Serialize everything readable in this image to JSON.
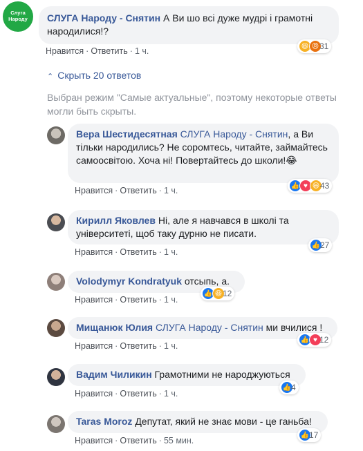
{
  "top_comment": {
    "author": "СЛУГА Народу - Снятин",
    "text": "А Ви шо всі дуже мудрі і грамотні народилися!?",
    "actions": [
      "Нравится",
      "Ответить"
    ],
    "time": "1 ч.",
    "reaction_count": "31",
    "reactions": [
      "haha-reaction-icon",
      "angry-reaction-icon"
    ],
    "avatar_logo": "Слуга Народу"
  },
  "replies_toggle": "Скрыть 20 ответов",
  "sort_notice": "Выбран режим \"Самые актуальные\", поэтому некоторые ответы могли быть скрыты.",
  "replies": [
    {
      "author": "Вера Шестидесятная",
      "mention": "СЛУГА Народу - Снятин",
      "text": ", а Ви тільки народились? Не соромтесь, читайте, займайтесь самоосвітою. Хоча ні! Повертайтесь до школи!",
      "emoji": "😂",
      "time": "1 ч.",
      "count": "43"
    },
    {
      "author": "Кирилл Яковлев",
      "mention": "",
      "text": "Ні, але я навчався в школі та університеті, щоб таку дурню не писати.",
      "time": "1 ч.",
      "count": "27"
    },
    {
      "author": "Volodymyr Kondratyuk",
      "mention": "",
      "text": "отсыпь, а.",
      "time": "1 ч.",
      "count": "12"
    },
    {
      "author": "Мищанюк Юлия",
      "mention": "СЛУГА Народу - Снятин",
      "text": "ми вчилися !",
      "time": "1 ч.",
      "count": "12"
    },
    {
      "author": "Вадим Чиликин",
      "mention": "",
      "text": "Грамотними не народжуються",
      "time": "1 ч.",
      "count": "4"
    },
    {
      "author": "Taras Moroz",
      "mention": "",
      "text": "Депутат, який не знає мови - це ганьба!",
      "time": "55 мин.",
      "count": "17"
    }
  ],
  "actions": {
    "like": "Нравится",
    "reply": "Ответить"
  },
  "colors": {
    "link": "#385898",
    "bubble": "#f2f3f5",
    "logo_green": "#22a845",
    "like": "#1877f2"
  }
}
